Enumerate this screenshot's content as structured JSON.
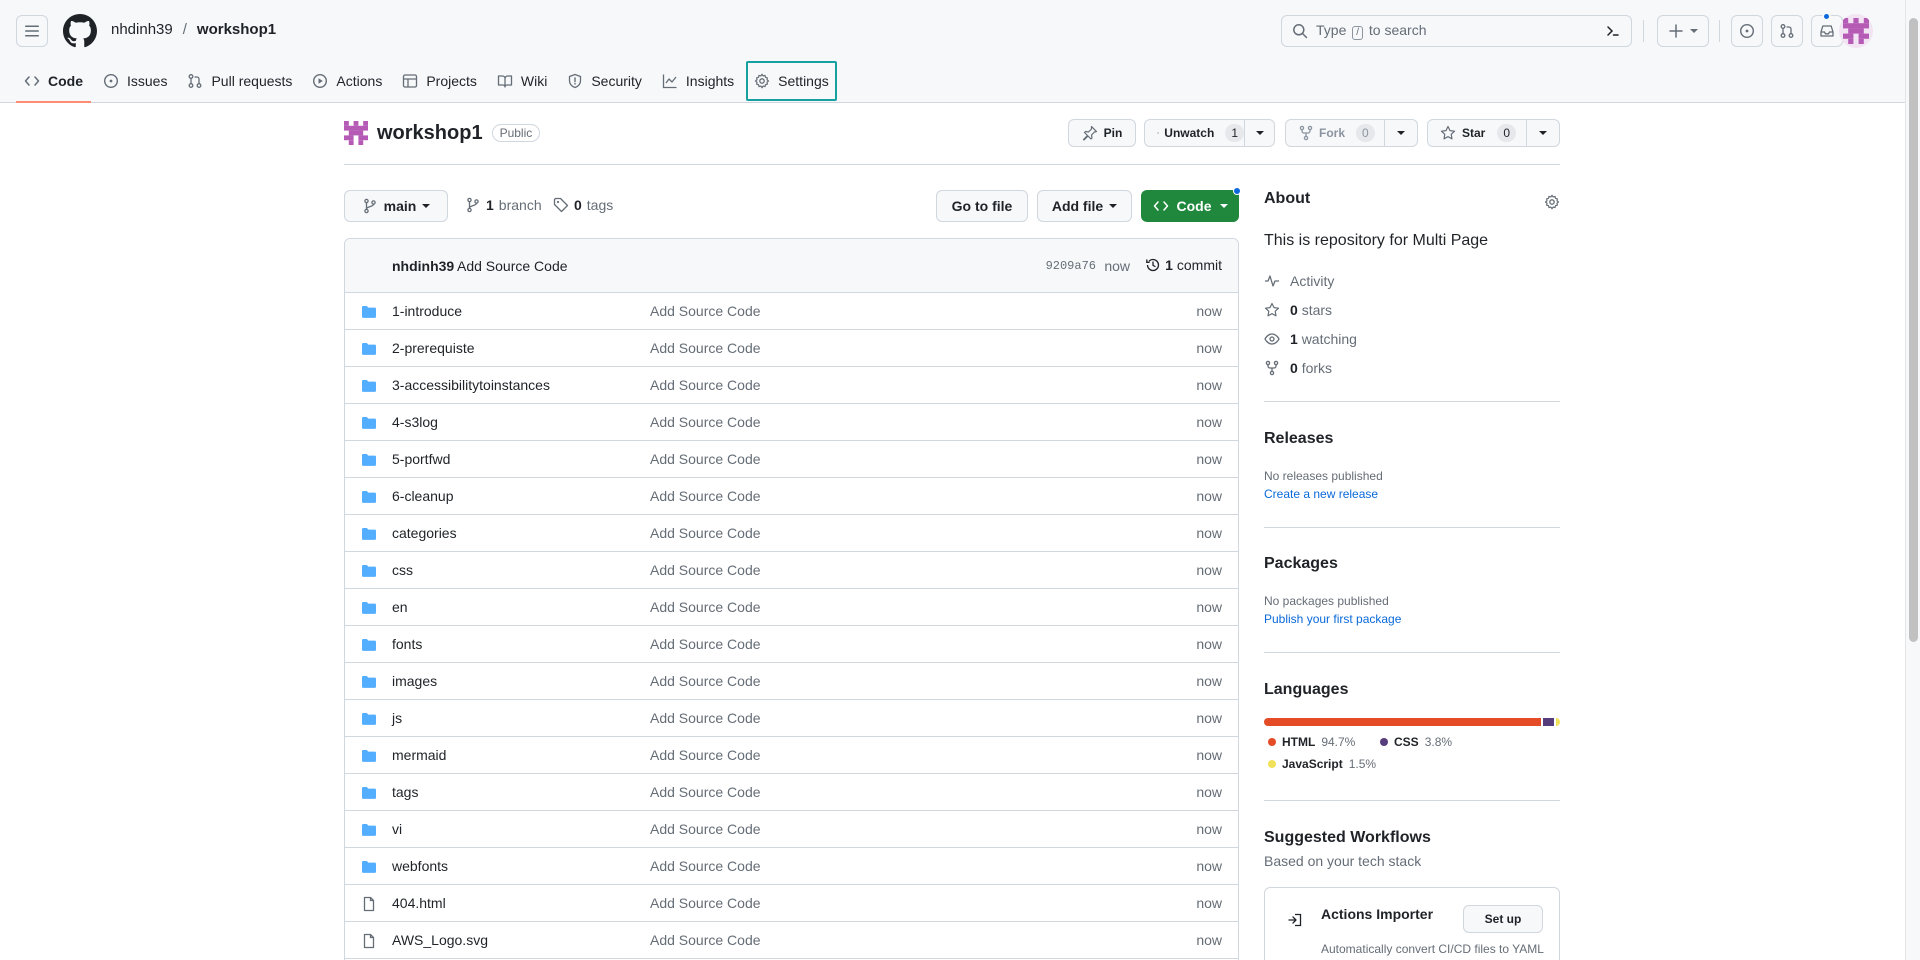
{
  "header": {
    "owner": "nhdinh39",
    "separator": "/",
    "repo": "workshop1",
    "search_prefix": "Type",
    "search_key": "/",
    "search_suffix": "to search"
  },
  "tabs": [
    {
      "label": "Code",
      "icon": "code-icon"
    },
    {
      "label": "Issues",
      "icon": "issue-icon"
    },
    {
      "label": "Pull requests",
      "icon": "pull-request-icon"
    },
    {
      "label": "Actions",
      "icon": "play-icon"
    },
    {
      "label": "Projects",
      "icon": "table-icon"
    },
    {
      "label": "Wiki",
      "icon": "book-icon"
    },
    {
      "label": "Security",
      "icon": "shield-icon"
    },
    {
      "label": "Insights",
      "icon": "graph-icon"
    },
    {
      "label": "Settings",
      "icon": "gear-icon"
    }
  ],
  "repo": {
    "name": "workshop1",
    "visibility": "Public",
    "pin": "Pin",
    "unwatch": "Unwatch",
    "watch_count": "1",
    "fork": "Fork",
    "fork_count": "0",
    "star": "Star",
    "star_count": "0"
  },
  "branchbar": {
    "branch": "main",
    "branch_count": "1",
    "branch_label": "branch",
    "tag_count": "0",
    "tag_label": "tags",
    "go_to_file": "Go to file",
    "add_file": "Add file",
    "code": "Code"
  },
  "commit": {
    "author": "nhdinh39",
    "message": "Add Source Code",
    "sha": "9209a76",
    "when": "now",
    "count": "1",
    "count_label": "commit"
  },
  "files": [
    {
      "name": "1-introduce",
      "type": "dir",
      "message": "Add Source Code",
      "time": "now"
    },
    {
      "name": "2-prerequiste",
      "type": "dir",
      "message": "Add Source Code",
      "time": "now"
    },
    {
      "name": "3-accessibilitytoinstances",
      "type": "dir",
      "message": "Add Source Code",
      "time": "now"
    },
    {
      "name": "4-s3log",
      "type": "dir",
      "message": "Add Source Code",
      "time": "now"
    },
    {
      "name": "5-portfwd",
      "type": "dir",
      "message": "Add Source Code",
      "time": "now"
    },
    {
      "name": "6-cleanup",
      "type": "dir",
      "message": "Add Source Code",
      "time": "now"
    },
    {
      "name": "categories",
      "type": "dir",
      "message": "Add Source Code",
      "time": "now"
    },
    {
      "name": "css",
      "type": "dir",
      "message": "Add Source Code",
      "time": "now"
    },
    {
      "name": "en",
      "type": "dir",
      "message": "Add Source Code",
      "time": "now"
    },
    {
      "name": "fonts",
      "type": "dir",
      "message": "Add Source Code",
      "time": "now"
    },
    {
      "name": "images",
      "type": "dir",
      "message": "Add Source Code",
      "time": "now"
    },
    {
      "name": "js",
      "type": "dir",
      "message": "Add Source Code",
      "time": "now"
    },
    {
      "name": "mermaid",
      "type": "dir",
      "message": "Add Source Code",
      "time": "now"
    },
    {
      "name": "tags",
      "type": "dir",
      "message": "Add Source Code",
      "time": "now"
    },
    {
      "name": "vi",
      "type": "dir",
      "message": "Add Source Code",
      "time": "now"
    },
    {
      "name": "webfonts",
      "type": "dir",
      "message": "Add Source Code",
      "time": "now"
    },
    {
      "name": "404.html",
      "type": "file",
      "message": "Add Source Code",
      "time": "now"
    },
    {
      "name": "AWS_Logo.svg",
      "type": "file",
      "message": "Add Source Code",
      "time": "now"
    }
  ],
  "about": {
    "title": "About",
    "description": "This is repository for Multi Page",
    "activity": "Activity",
    "stars_count": "0",
    "stars_label": "stars",
    "watching_count": "1",
    "watching_label": "watching",
    "forks_count": "0",
    "forks_label": "forks"
  },
  "releases": {
    "title": "Releases",
    "none": "No releases published",
    "create": "Create a new release"
  },
  "packages": {
    "title": "Packages",
    "none": "No packages published",
    "publish": "Publish your first package"
  },
  "languages": {
    "title": "Languages",
    "items": [
      {
        "name": "HTML",
        "percent": "94.7%",
        "value": 94.7,
        "color": "#e34c26"
      },
      {
        "name": "CSS",
        "percent": "3.8%",
        "value": 3.8,
        "color": "#563d7c"
      },
      {
        "name": "JavaScript",
        "percent": "1.5%",
        "value": 1.5,
        "color": "#f1e05a"
      }
    ]
  },
  "workflows": {
    "title": "Suggested Workflows",
    "subtitle": "Based on your tech stack",
    "card_title": "Actions Importer",
    "card_desc": "Automatically convert CI/CD files to YAML",
    "setup": "Set up"
  },
  "colors": {
    "accent_green": "#1f883d",
    "link_blue": "#0969da",
    "tab_underline": "#fd8c73",
    "highlight_box": "#16a0a0",
    "folder_blue": "#54aeff"
  }
}
